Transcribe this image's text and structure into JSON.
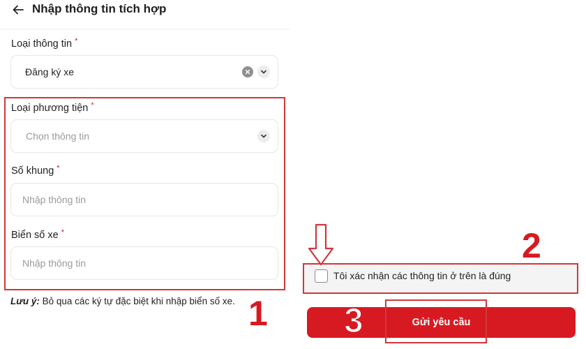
{
  "header": {
    "title": "Nhập thông tin tích hợp"
  },
  "fields": [
    {
      "label": "Loại thông tin",
      "required_mark": "*",
      "value": "Đăng ký xe"
    },
    {
      "label": "Loại phương tiện",
      "required_mark": "*",
      "placeholder": "Chọn thông tin"
    },
    {
      "label": "Số khung",
      "required_mark": "*",
      "placeholder": "Nhập thông tin"
    },
    {
      "label": "Biển số xe",
      "required_mark": "*",
      "placeholder": "Nhập thông tin"
    }
  ],
  "note": {
    "prefix": "Lưu ý:",
    "text": " Bỏ qua các ký tự đặc biệt khi nhập biển số xe."
  },
  "confirm": {
    "label": "Tôi xác nhận các thông tin ở trên là đúng",
    "checked": false
  },
  "submit": {
    "label": "Gửi yêu cầu"
  },
  "annotations": {
    "step1": "1",
    "step2": "2",
    "step3": "3"
  },
  "colors": {
    "brand_red": "#d71a21",
    "annotation_red": "#d0373b",
    "border": "#e6e6e6"
  },
  "icons": {
    "back": "arrow-left-icon",
    "clear": "clear-circle-icon",
    "dropdown": "chevron-down-icon",
    "pointer": "arrow-down-outline-icon"
  }
}
